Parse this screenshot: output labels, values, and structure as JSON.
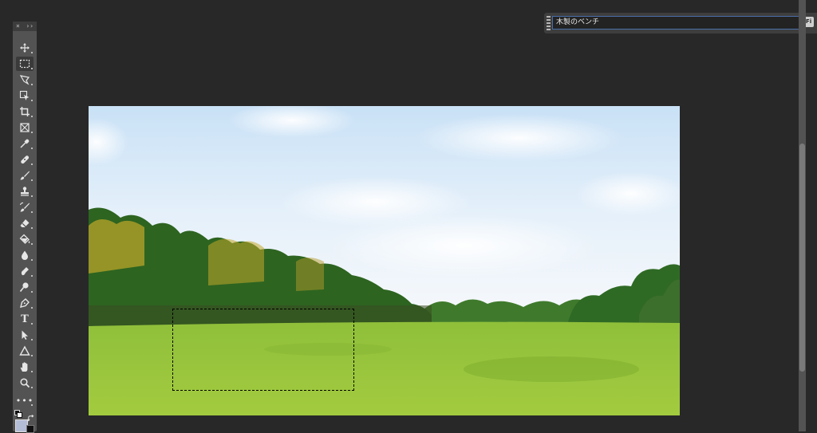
{
  "toolbar": {
    "close_glyph": "×",
    "collapse_glyph": "››",
    "tools": [
      {
        "name": "move-tool",
        "icon": "move-icon"
      },
      {
        "name": "rectangular-marquee-tool",
        "icon": "marquee-icon",
        "active": true
      },
      {
        "name": "lasso-tool",
        "icon": "lasso-icon"
      },
      {
        "name": "object-selection-tool",
        "icon": "object-select-icon"
      },
      {
        "name": "crop-tool",
        "icon": "crop-icon"
      },
      {
        "name": "frame-tool",
        "icon": "frame-icon"
      },
      {
        "name": "eyedropper-tool",
        "icon": "eyedropper-icon"
      },
      {
        "name": "healing-brush-tool",
        "icon": "bandage-icon"
      },
      {
        "name": "brush-tool",
        "icon": "brush-icon"
      },
      {
        "name": "clone-stamp-tool",
        "icon": "stamp-icon"
      },
      {
        "name": "history-brush-tool",
        "icon": "history-brush-icon"
      },
      {
        "name": "eraser-tool",
        "icon": "eraser-icon"
      },
      {
        "name": "paint-bucket-tool",
        "icon": "bucket-icon"
      },
      {
        "name": "blur-tool",
        "icon": "drop-icon"
      },
      {
        "name": "dodge-tool",
        "icon": "dodge-icon"
      },
      {
        "name": "pen-tool",
        "icon": "pen-icon"
      },
      {
        "name": "type-tool",
        "icon": "type-icon",
        "label": "T"
      },
      {
        "name": "path-selection-tool",
        "icon": "arrow-icon"
      },
      {
        "name": "shape-tool",
        "icon": "triangle-icon"
      },
      {
        "name": "hand-tool",
        "icon": "hand-icon"
      },
      {
        "name": "zoom-tool",
        "icon": "magnifier-icon"
      },
      {
        "name": "edit-toolbar",
        "icon": "more-icon",
        "label": "•••"
      }
    ],
    "foreground_color": "#1a1a1a",
    "background_color": "#ffffff",
    "swatch_color": "#b4bdd6"
  },
  "search": {
    "value": "木製のベンチ",
    "badge": "Fi"
  },
  "canvas": {
    "selection_visible": true
  }
}
